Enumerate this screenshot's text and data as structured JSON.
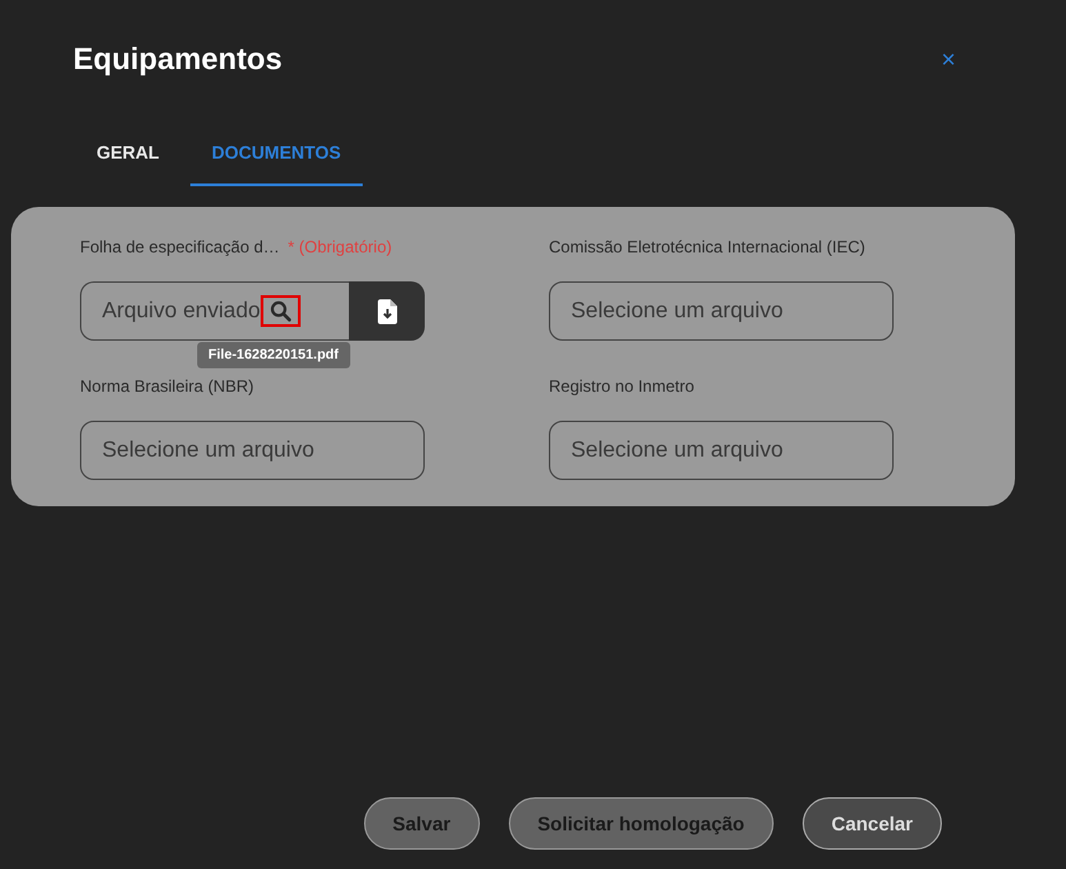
{
  "window": {
    "title": "Equipamentos",
    "close": "×"
  },
  "tabs": [
    {
      "label": "GERAL",
      "selected": false
    },
    {
      "label": "DOCUMENTOS",
      "selected": true
    }
  ],
  "fields": [
    {
      "label": "Folha de especificação d…",
      "required": "* (Obrigatório)",
      "value": "Arquivo enviado",
      "uploaded": true,
      "search_highlighted": true,
      "tooltip": "File-1628220151.pdf"
    },
    {
      "label": "Comissão Eletrotécnica Internacional (IEC)",
      "placeholder": "Selecione um arquivo",
      "uploaded": false
    },
    {
      "label": "Norma Brasileira (NBR)",
      "placeholder": "Selecione um arquivo",
      "uploaded": false
    },
    {
      "label": "Registro no Inmetro",
      "placeholder": "Selecione um arquivo",
      "uploaded": false
    }
  ],
  "buttons": [
    {
      "label": "Salvar",
      "disabled": true
    },
    {
      "label": "Solicitar homologação",
      "disabled": true
    },
    {
      "label": "Cancelar",
      "disabled": false
    }
  ]
}
